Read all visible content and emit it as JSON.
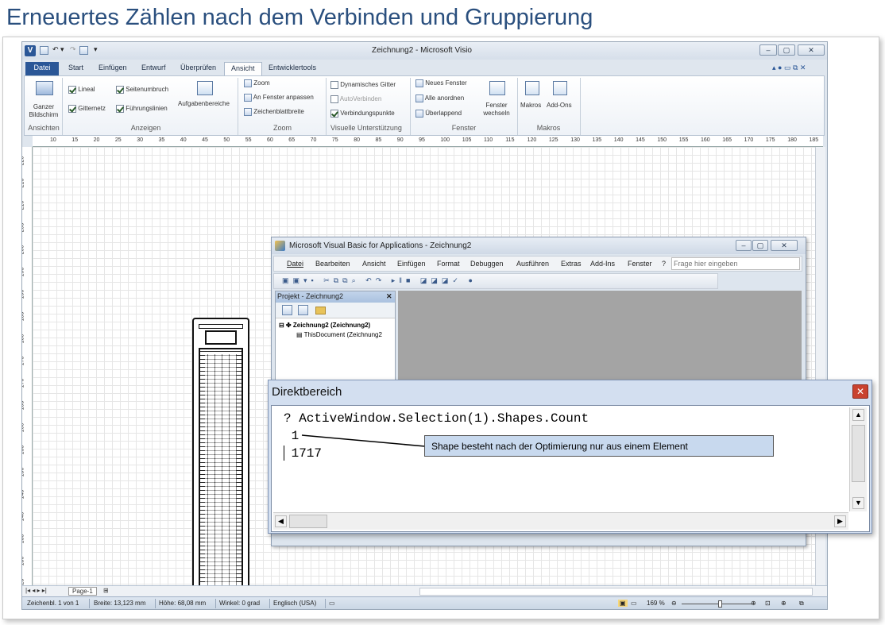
{
  "slide_title": "Erneuertes Zählen nach dem Verbinden und Gruppierung",
  "visio": {
    "window_title": "Zeichnung2 - Microsoft Visio",
    "tabs": [
      "Datei",
      "Start",
      "Einfügen",
      "Entwurf",
      "Überprüfen",
      "Ansicht",
      "Entwicklertools"
    ],
    "active_tab": "Ansicht",
    "ribbon": {
      "ansichten": {
        "button": "Ganzer Bildschirm",
        "label": "Ansichten"
      },
      "anzeigen": {
        "lineal": "Lineal",
        "seitenumbruch": "Seitenumbruch",
        "gitternetz": "Gitternetz",
        "fuehrungslinien": "Führungslinien",
        "aufgabenbereiche": "Aufgabenbereiche",
        "label": "Anzeigen"
      },
      "zoom": {
        "zoom": "Zoom",
        "fit": "An Fenster anpassen",
        "width": "Zeichenblattbreite",
        "label": "Zoom"
      },
      "visuelle": {
        "dyn_grid": "Dynamisches Gitter",
        "autoverbinden": "AutoVerbinden",
        "verbindungspunkte": "Verbindungspunkte",
        "label": "Visuelle Unterstützung"
      },
      "fenster": {
        "neues": "Neues Fenster",
        "anordnen": "Alle anordnen",
        "ueberlappend": "Überlappend",
        "wechseln": "Fenster wechseln",
        "label": "Fenster"
      },
      "makros": {
        "makros": "Makros",
        "addons": "Add-Ons",
        "label": "Makros"
      }
    },
    "ruler_h": [
      "10",
      "15",
      "20",
      "25",
      "30",
      "35",
      "40",
      "45",
      "50",
      "55",
      "60",
      "65",
      "70",
      "75",
      "80",
      "85",
      "90",
      "95",
      "100",
      "105",
      "110",
      "115",
      "120",
      "125",
      "130",
      "135",
      "140",
      "145",
      "150",
      "155",
      "160",
      "165",
      "170",
      "175",
      "180",
      "185"
    ],
    "ruler_v": [
      "220",
      "215",
      "210",
      "205",
      "200",
      "195",
      "190",
      "185",
      "180",
      "175",
      "170",
      "165",
      "160",
      "155",
      "150",
      "145",
      "140",
      "135",
      "130",
      "125"
    ],
    "page_tab": "Page-1",
    "status": {
      "sheet": "Zeichenbl. 1 von 1",
      "width": "Breite: 13,123 mm",
      "height": "Höhe: 68,08 mm",
      "angle": "Winkel: 0 grad",
      "language": "Englisch (USA)",
      "zoom": "169 %"
    }
  },
  "vba": {
    "title": "Microsoft Visual Basic for Applications - Zeichnung2",
    "menu": [
      "Datei",
      "Bearbeiten",
      "Ansicht",
      "Einfügen",
      "Format",
      "Debuggen",
      "Ausführen",
      "Extras",
      "Add-Ins",
      "Fenster",
      "?"
    ],
    "help_placeholder": "Frage hier eingeben",
    "project_title": "Projekt - Zeichnung2",
    "tree_root": "Zeichnung2 (Zeichnung2)",
    "tree_child": "ThisDocument (Zeichnung2"
  },
  "direktbereich": {
    "title": "Direktbereich",
    "lines": [
      "? ActiveWindow.Selection(1).Shapes.Count",
      " 1",
      " 1717"
    ],
    "callout": "Shape besteht nach der Optimierung nur aus einem Element"
  },
  "colors": {
    "title": "#2a4f7e",
    "datei_tab": "#2b5797",
    "callout": "#c8d9ee",
    "close_red": "#c9422f"
  }
}
